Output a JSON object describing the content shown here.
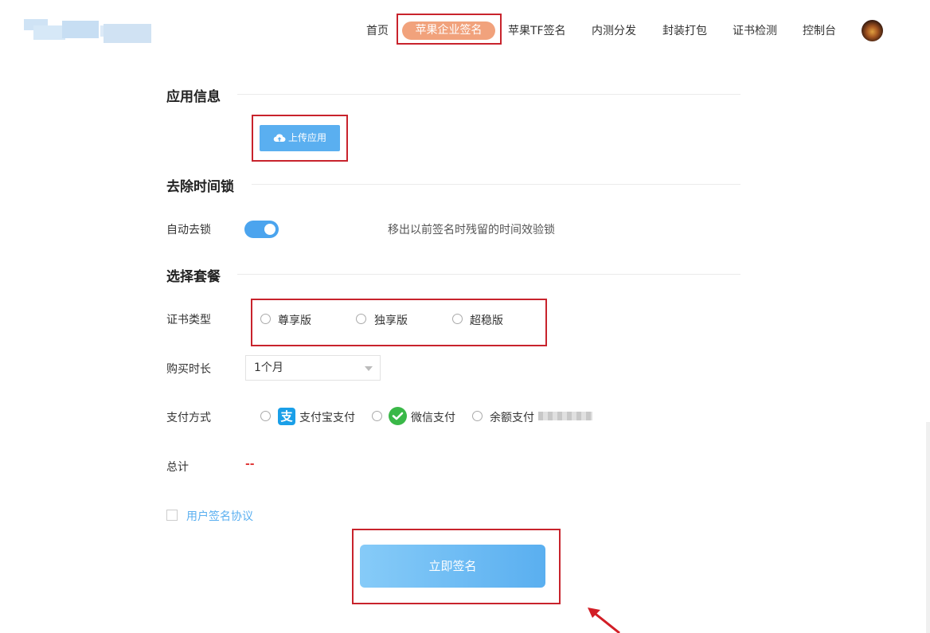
{
  "header": {
    "nav": [
      {
        "label": "首页"
      },
      {
        "label": "苹果企业签名"
      },
      {
        "label": "苹果TF签名"
      },
      {
        "label": "内测分发"
      },
      {
        "label": "封装打包"
      },
      {
        "label": "证书检测"
      },
      {
        "label": "控制台"
      }
    ],
    "active_color": "#f1a27c"
  },
  "app_info": {
    "title": "应用信息",
    "upload_label": "上传应用"
  },
  "time_lock": {
    "title": "去除时间锁",
    "auto_unlock_label": "自动去锁",
    "auto_unlock_on": true,
    "hint": "移出以前签名时残留的时间效验锁"
  },
  "plan": {
    "title": "选择套餐",
    "cert_type_label": "证书类型",
    "cert_options": [
      "尊享版",
      "独享版",
      "超稳版"
    ],
    "duration_label": "购买时长",
    "duration_value": "1个月",
    "payment_label": "支付方式",
    "payment_options": [
      {
        "label": "支付宝支付",
        "icon": "alipay-icon"
      },
      {
        "label": "微信支付",
        "icon": "wechat-icon"
      },
      {
        "label": "余额支付",
        "icon": ""
      }
    ],
    "total_label": "总计",
    "total_value": "--"
  },
  "agreement": {
    "label": "用户签名协议"
  },
  "submit": {
    "label": "立即签名"
  },
  "colors": {
    "primary": "#5aaff0",
    "highlight_box": "#c8232c",
    "total": "#e03a3a"
  }
}
